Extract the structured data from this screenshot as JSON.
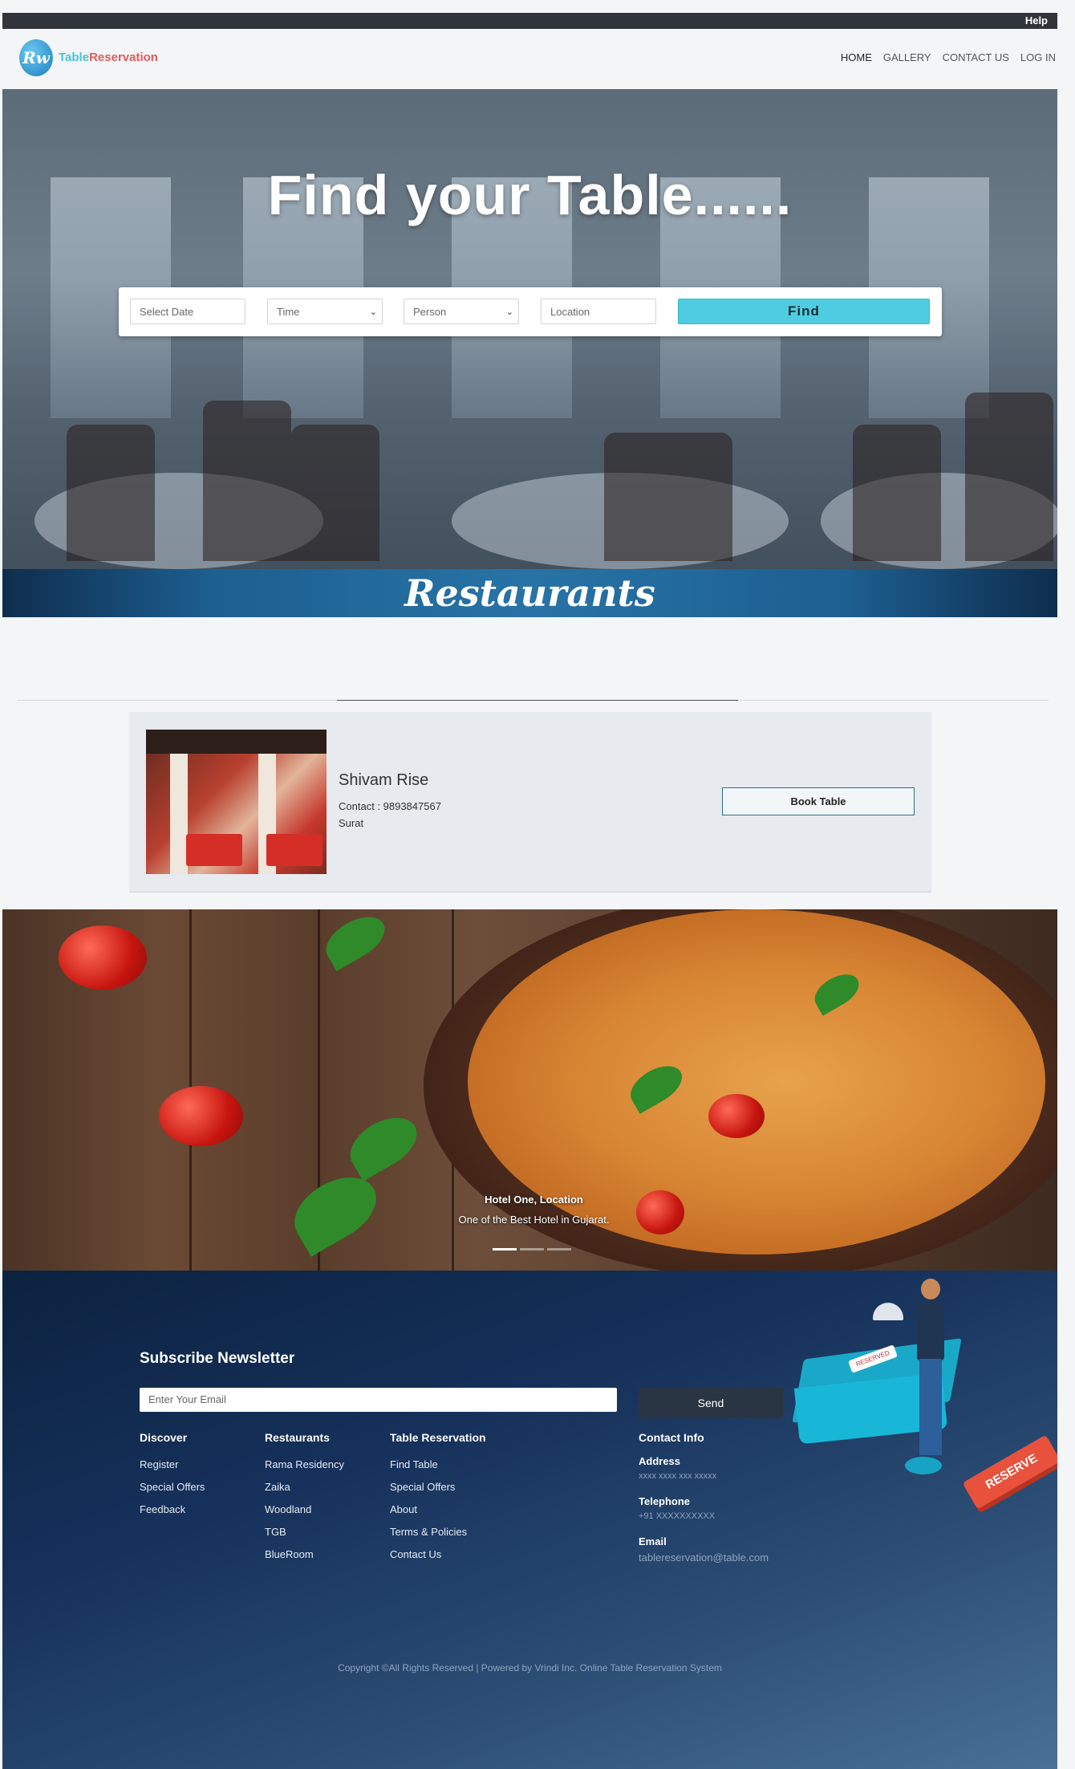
{
  "topbar": {
    "help": "Help"
  },
  "brand": {
    "badge": "Rw",
    "name_part1": "Table",
    "name_part2": "Reservation"
  },
  "nav": {
    "home": "HOME",
    "gallery": "GALLERY",
    "contact": "CONTACT US",
    "login": "LOG IN"
  },
  "hero": {
    "title": "Find your Table......"
  },
  "search": {
    "date_placeholder": "Select Date",
    "time_label": "Time",
    "person_label": "Person",
    "location_placeholder": "Location",
    "find_label": "Find"
  },
  "section_banner": "Restaurants",
  "restaurant": {
    "name": "Shivam Rise",
    "contact": "Contact : 9893847567",
    "city": "Surat",
    "book_label": "Book Table"
  },
  "slider": {
    "caption_title": "Hotel One, Location",
    "caption_sub": "One of the Best Hotel in Gujarat.",
    "active_slide": 1,
    "slide_count": 3
  },
  "footer": {
    "newsletter_title": "Subscribe Newsletter",
    "email_placeholder": "Enter Your Email",
    "send_label": "Send",
    "discover": {
      "title": "Discover",
      "items": [
        "Register",
        "Special Offers",
        "Feedback"
      ]
    },
    "restaurants": {
      "title": "Restaurants",
      "items": [
        "Rama Residency",
        "Zaika",
        "Woodland",
        "TGB",
        "BlueRoom"
      ]
    },
    "table_reservation": {
      "title": "Table Reservation",
      "items": [
        "Find Table",
        "Special Offers",
        "About",
        "Terms & Policies",
        "Contact Us"
      ]
    },
    "contact_info": {
      "title": "Contact Info",
      "address_label": "Address",
      "address_value": "xxxx xxxx xxx xxxxx",
      "telephone_label": "Telephone",
      "telephone_value": "+91 XXXXXXXXXX",
      "email_label": "Email",
      "email_value": "tablereservation@table.com"
    },
    "illustration": {
      "sign": "RESERVE",
      "tag": "RESERVED"
    },
    "copyright": "Copyright ©All Rights Reserved | Powered by Vrindi Inc. Online Table Reservation System"
  },
  "colors": {
    "accent": "#4fcde0",
    "brand_red": "#e25b59",
    "brand_teal": "#48c2d6",
    "footer_dark": "#0c2240",
    "topbar": "#30353b"
  }
}
